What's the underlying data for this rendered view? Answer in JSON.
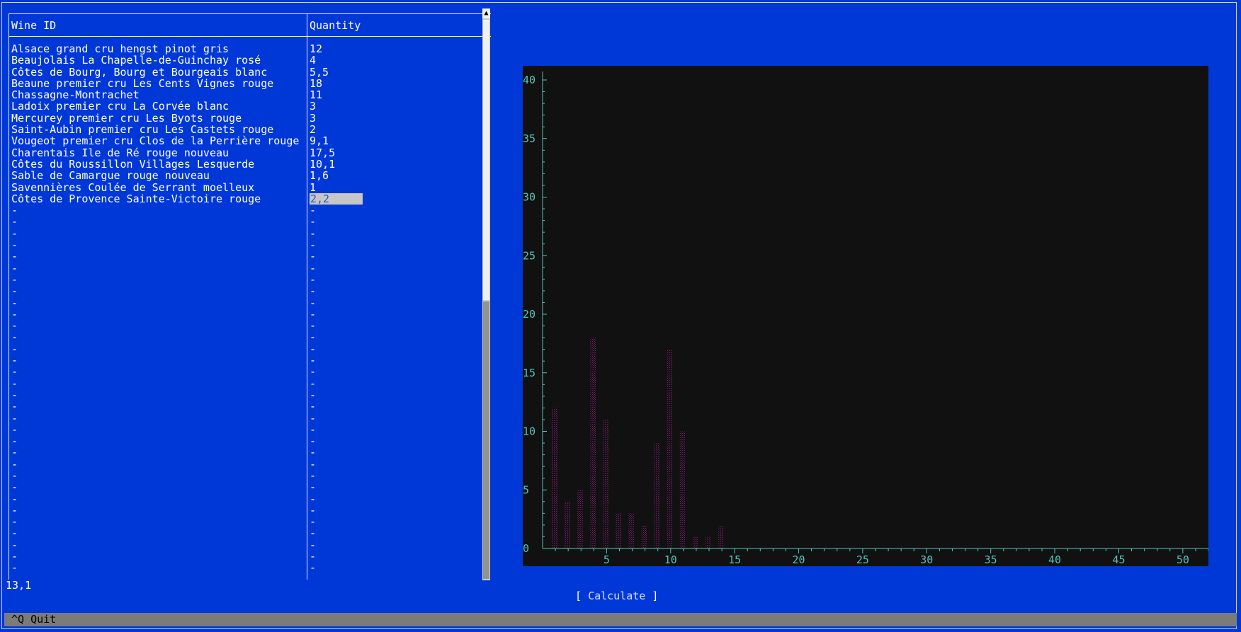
{
  "table": {
    "headers": {
      "wine_id": "Wine ID",
      "quantity": "Quantity"
    },
    "rows": [
      {
        "id": "Alsace grand cru hengst pinot gris",
        "qty": "12"
      },
      {
        "id": "Beaujolais La Chapelle-de-Guinchay rosé",
        "qty": "4"
      },
      {
        "id": "Côtes de Bourg, Bourg et Bourgeais blanc",
        "qty": "5,5"
      },
      {
        "id": "Beaune premier cru Les Cents Vignes rouge",
        "qty": "18"
      },
      {
        "id": "Chassagne-Montrachet",
        "qty": "11"
      },
      {
        "id": "Ladoix premier cru La Corvée blanc",
        "qty": "3"
      },
      {
        "id": "Mercurey premier cru Les Byots rouge",
        "qty": "3"
      },
      {
        "id": "Saint-Aubin premier cru Les Castets rouge",
        "qty": "2"
      },
      {
        "id": "Vougeot premier cru Clos de la Perrière rouge",
        "qty": "9,1"
      },
      {
        "id": "Charentais Ile de Ré rouge nouveau",
        "qty": "17,5"
      },
      {
        "id": "Côtes du Roussillon Villages Lesquerde",
        "qty": "10,1"
      },
      {
        "id": "Sable de Camargue rouge nouveau",
        "qty": "1,6"
      },
      {
        "id": "Savennières Coulée de Serrant moelleux",
        "qty": "1"
      },
      {
        "id": "Côtes de Provence Sainte-Victoire rouge",
        "qty": "2,2",
        "selected": true
      }
    ],
    "empty_placeholder": "-",
    "empty_row_count": 32
  },
  "status_value": "13,1",
  "calculate_button": {
    "open": "[ ",
    "label": "Calculate",
    "close": " ]"
  },
  "menu_bar": {
    "quit_label": "^Q Quit"
  },
  "colors": {
    "background": "#0038d8",
    "chart_background": "#111111",
    "axis": "#56c3b7",
    "bar_outline": "#7a1a6a",
    "selected_cell_bg": "#c6c6c6",
    "selected_cell_fg": "#2b56c2",
    "menu_bar_bg": "#7b7b7b"
  },
  "chart_data": {
    "type": "bar",
    "x": [
      1,
      2,
      3,
      4,
      5,
      6,
      7,
      8,
      9,
      10,
      11,
      12,
      13,
      14
    ],
    "values": [
      12,
      4,
      5,
      18,
      11,
      3,
      3,
      2,
      9,
      17,
      10,
      1,
      1,
      2
    ],
    "x_ticks": [
      "5",
      "10",
      "15",
      "20",
      "25",
      "30",
      "35",
      "40",
      "45",
      "50"
    ],
    "y_ticks": [
      "0",
      "5",
      "10",
      "15",
      "20",
      "25",
      "30",
      "35",
      "40"
    ],
    "xlim": [
      0,
      52
    ],
    "ylim": [
      0,
      40
    ]
  }
}
